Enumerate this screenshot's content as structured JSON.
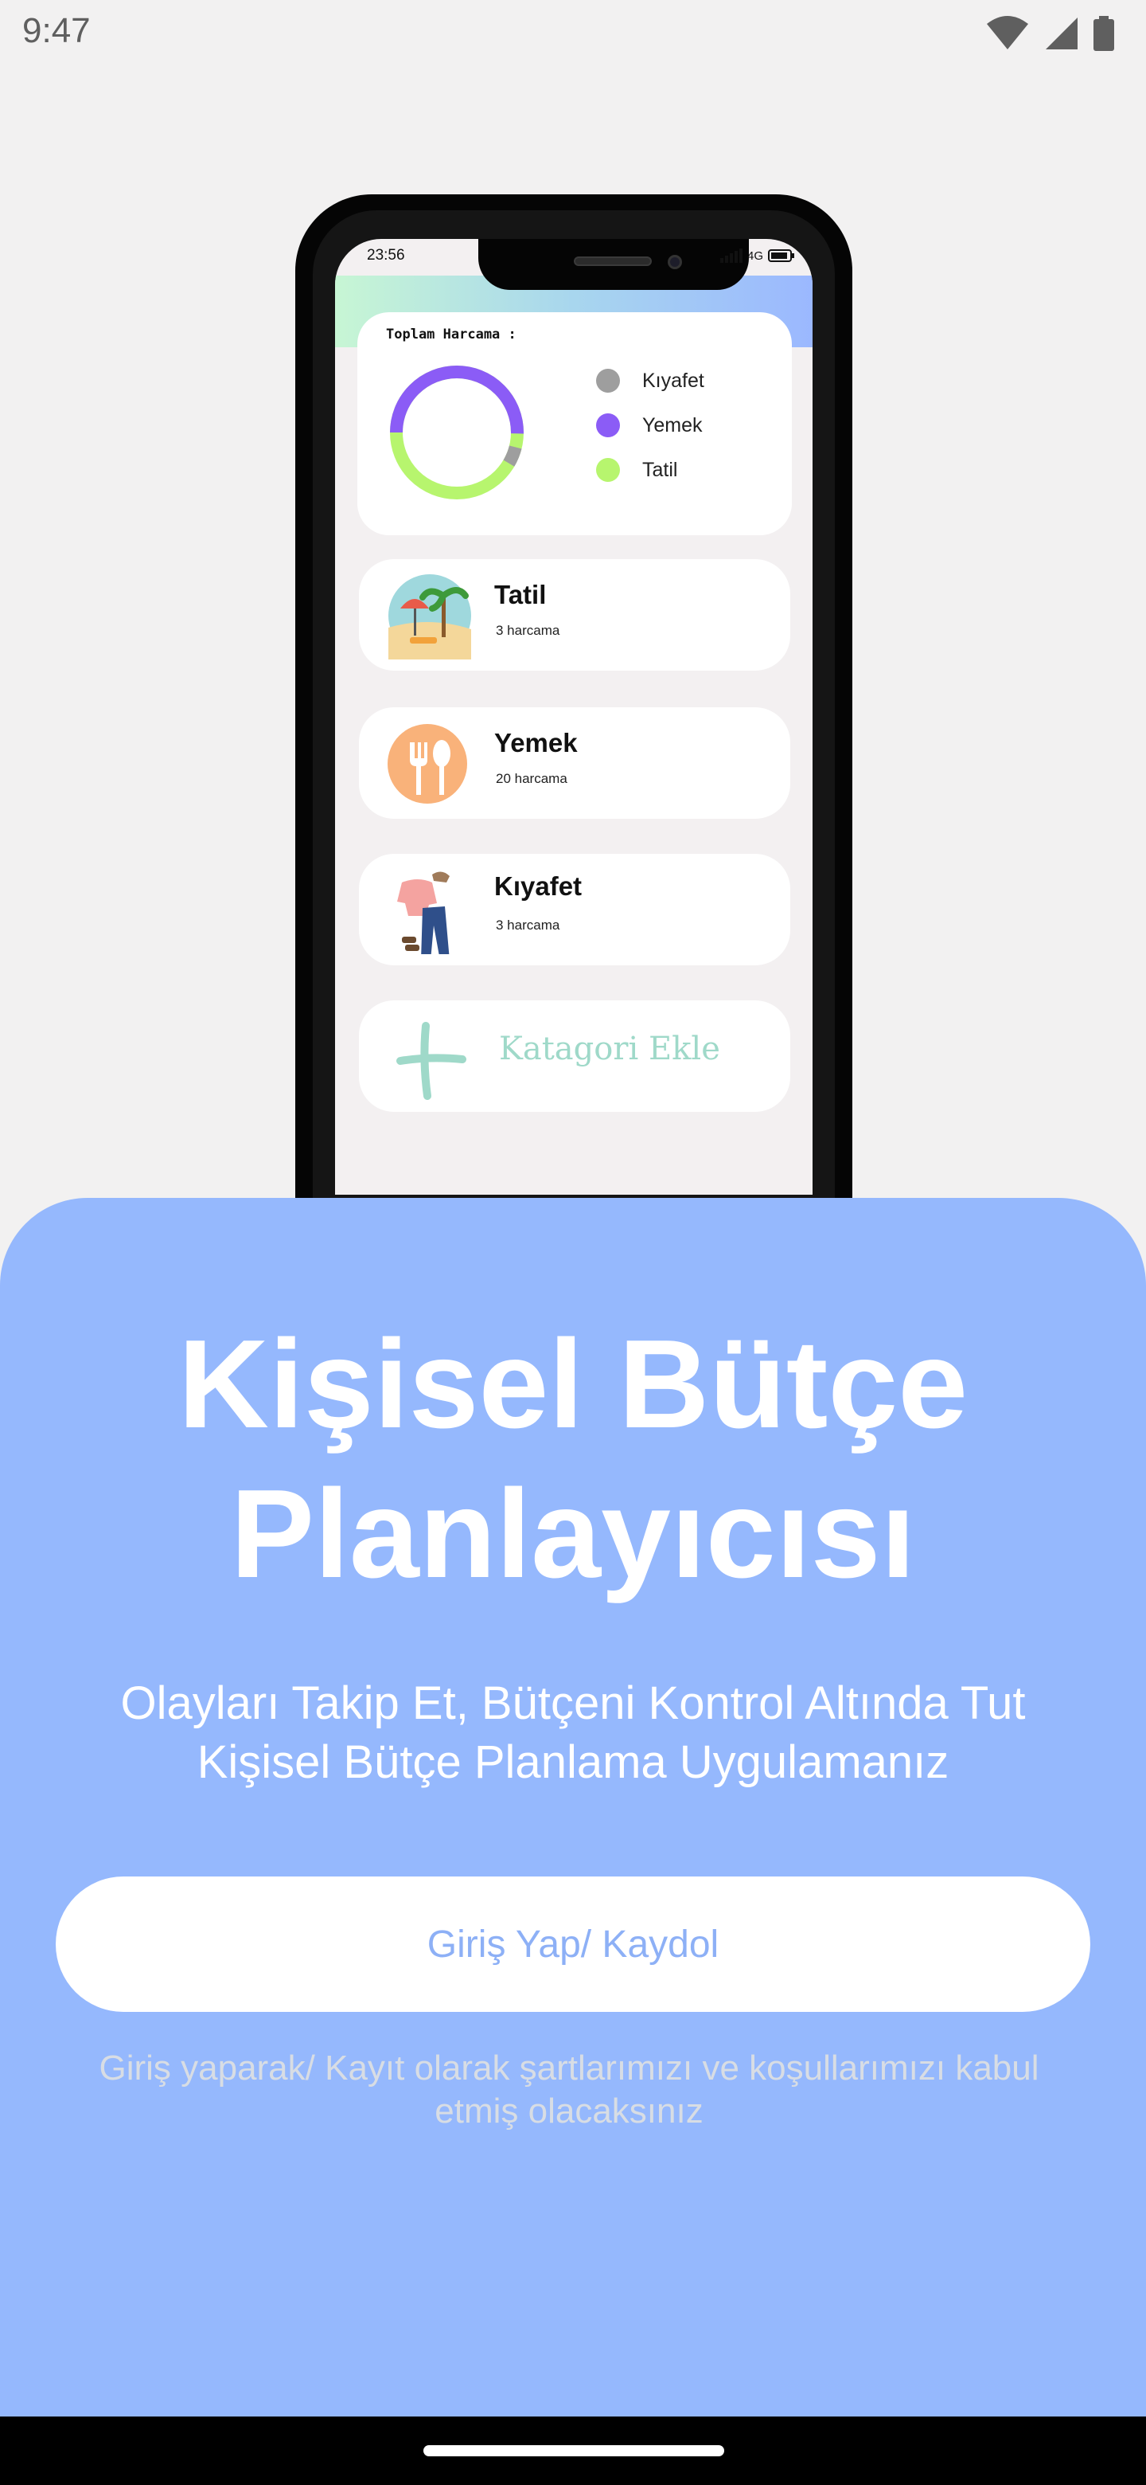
{
  "status_bar": {
    "time": "9:47",
    "icons": [
      "wifi-icon",
      "signal-icon",
      "battery-icon"
    ]
  },
  "mockup": {
    "time": "23:56",
    "network": "4G",
    "summary": {
      "title": "Toplam Harcama :",
      "legend": [
        {
          "label": "Kıyafet",
          "color": "#9e9e9e"
        },
        {
          "label": "Yemek",
          "color": "#8b5cf6"
        },
        {
          "label": "Tatil",
          "color": "#b7f56e"
        }
      ]
    },
    "categories": [
      {
        "name": "Tatil",
        "count": "3 harcama",
        "icon": "beach-icon"
      },
      {
        "name": "Yemek",
        "count": "20 harcama",
        "icon": "fork-spoon-icon"
      },
      {
        "name": "Kıyafet",
        "count": "3 harcama",
        "icon": "clothes-icon"
      }
    ],
    "add_category": "Katagori Ekle"
  },
  "sheet": {
    "headline_line1": "Kişisel Bütçe",
    "headline_line2": "Planlayıcısı",
    "subtitle_line1": "Olayları Takip Et, Bütçeni Kontrol Altında Tut",
    "subtitle_line2": "Kişisel Bütçe Planlama Uygulamanız",
    "cta_label": "Giriş Yap/ Kaydol",
    "terms_line1": "Giriş yaparak/ Kayıt olarak şartlarımızı ve koşullarımızı kabul",
    "terms_line2": "etmiş olacaksınız"
  },
  "colors": {
    "sheet": "#95b8fd",
    "cta_text": "#8db0f6",
    "background": "#f2f1f1"
  }
}
